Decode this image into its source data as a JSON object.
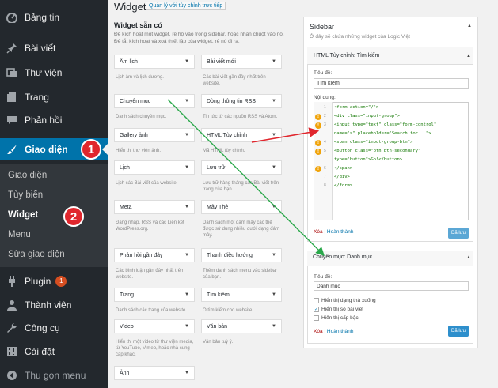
{
  "menu": {
    "items": [
      {
        "label": "Bảng tin",
        "icon": "dashboard-icon"
      },
      {
        "label": "Bài viết",
        "icon": "pin-icon"
      },
      {
        "label": "Thư viện",
        "icon": "media-icon"
      },
      {
        "label": "Trang",
        "icon": "page-icon"
      },
      {
        "label": "Phản hồi",
        "icon": "comment-icon"
      },
      {
        "label": "Giao diện",
        "icon": "brush-icon"
      },
      {
        "label": "Plugin",
        "icon": "plugin-icon",
        "badge": "1"
      },
      {
        "label": "Thành viên",
        "icon": "user-icon"
      },
      {
        "label": "Công cụ",
        "icon": "wrench-icon"
      },
      {
        "label": "Cài đặt",
        "icon": "settings-icon"
      },
      {
        "label": "Thu gọn menu",
        "icon": "collapse-icon"
      }
    ],
    "submenu": [
      "Giao diện",
      "Tùy biến",
      "Widget",
      "Menu",
      "Sửa giao diện"
    ],
    "callouts": [
      "1",
      "2"
    ]
  },
  "page": {
    "title": "Widget",
    "manage_link": "Quản lý với tùy chỉnh trực tiếp",
    "available_title": "Widget sẵn có",
    "available_desc": "Để kích hoạt một widget, rê hộ vào trong sidebar, hoặc nhấn chuột vào nó. Để tắt kích hoạt và xoá thiết lập của widget, rê nó đi ra."
  },
  "widgets": [
    {
      "name": "Âm lịch",
      "desc": "Lịch âm và lịch dương."
    },
    {
      "name": "Bài viết mới",
      "desc": "Các bài viết gần đây nhất trên website."
    },
    {
      "name": "Chuyên mục",
      "desc": "Danh sách chuyên mục."
    },
    {
      "name": "Dòng thông tin RSS",
      "desc": "Tin tức từ các nguồn RSS và Atom."
    },
    {
      "name": "Gallery ảnh",
      "desc": "Hiển thị thư viện ảnh."
    },
    {
      "name": "HTML Tùy chỉnh",
      "desc": "Mã HTML tùy chỉnh."
    },
    {
      "name": "Lịch",
      "desc": "Lịch các Bài viết của website."
    },
    {
      "name": "Lưu trữ",
      "desc": "Lưu trữ hàng tháng các Bài viết trên trang của bạn."
    },
    {
      "name": "Meta",
      "desc": "Đăng nhập, RSS và các Liên kết WordPress.org."
    },
    {
      "name": "Mây Thẻ",
      "desc": "Danh sách một đám mây các thẻ được sử dụng nhiều dưới dạng đám mây."
    },
    {
      "name": "Phản hồi gần đây",
      "desc": "Các bình luận gần đây nhất trên website."
    },
    {
      "name": "Thanh điều hướng",
      "desc": "Thêm danh sách menu vào sidebar của bạn."
    },
    {
      "name": "Trang",
      "desc": "Danh sách các trang của website."
    },
    {
      "name": "Tìm kiếm",
      "desc": "Ô tìm kiếm cho website."
    },
    {
      "name": "Video",
      "desc": "Hiển thị một video từ thư viện media, từ YouTube, Vimeo, hoặc nhà cung cấp khác."
    },
    {
      "name": "Văn bản",
      "desc": "Văn bản tuỳ ý."
    },
    {
      "name": "Ảnh",
      "desc": ""
    }
  ],
  "sidebar": {
    "title": "Sidebar",
    "desc": "Ở đây sẽ chứa những widget của Logic Việt",
    "html_widget": {
      "title": "HTML Tùy chỉnh: Tìm kiếm",
      "title_label": "Tiêu đề:",
      "title_value": "Tìm kiếm",
      "content_label": "Nội dung:",
      "code_lines": [
        "<form action=\"/\">",
        "  <div class=\"input-group\">",
        "    <input type=\"text\" class=\"form-control\"",
        "name=\"s\" placeholder=\"Search for...\">",
        "    <span class=\"input-group-btn\">",
        "      <button class=\"btn btn-secondary\"",
        "type=\"button\">Go!</button>",
        "    </span>",
        "  </div>",
        "</form>"
      ],
      "line_numbers": [
        "1",
        "2",
        "3",
        "",
        "4",
        "5",
        "",
        "6",
        "7",
        "8"
      ],
      "delete_label": "Xóa",
      "separator": "|",
      "done_label": "Hoàn thành",
      "save_label": "Đã lưu"
    },
    "cat_widget": {
      "title": "Chuyên mục: Danh mục",
      "title_label": "Tiêu đề:",
      "title_value": "Danh mục",
      "options": [
        {
          "label": "Hiển thị dạng thả xuống",
          "checked": false
        },
        {
          "label": "Hiển thị số bài viết",
          "checked": true
        },
        {
          "label": "Hiển thị cấp bậc",
          "checked": false
        }
      ],
      "delete_label": "Xóa",
      "separator": "|",
      "done_label": "Hoàn thành",
      "save_label": "Đã lưu"
    }
  },
  "colors": {
    "accent": "#0073aa",
    "arrow_red": "#e0262d",
    "arrow_green": "#2aa84a",
    "warn": "#f0a30a"
  }
}
